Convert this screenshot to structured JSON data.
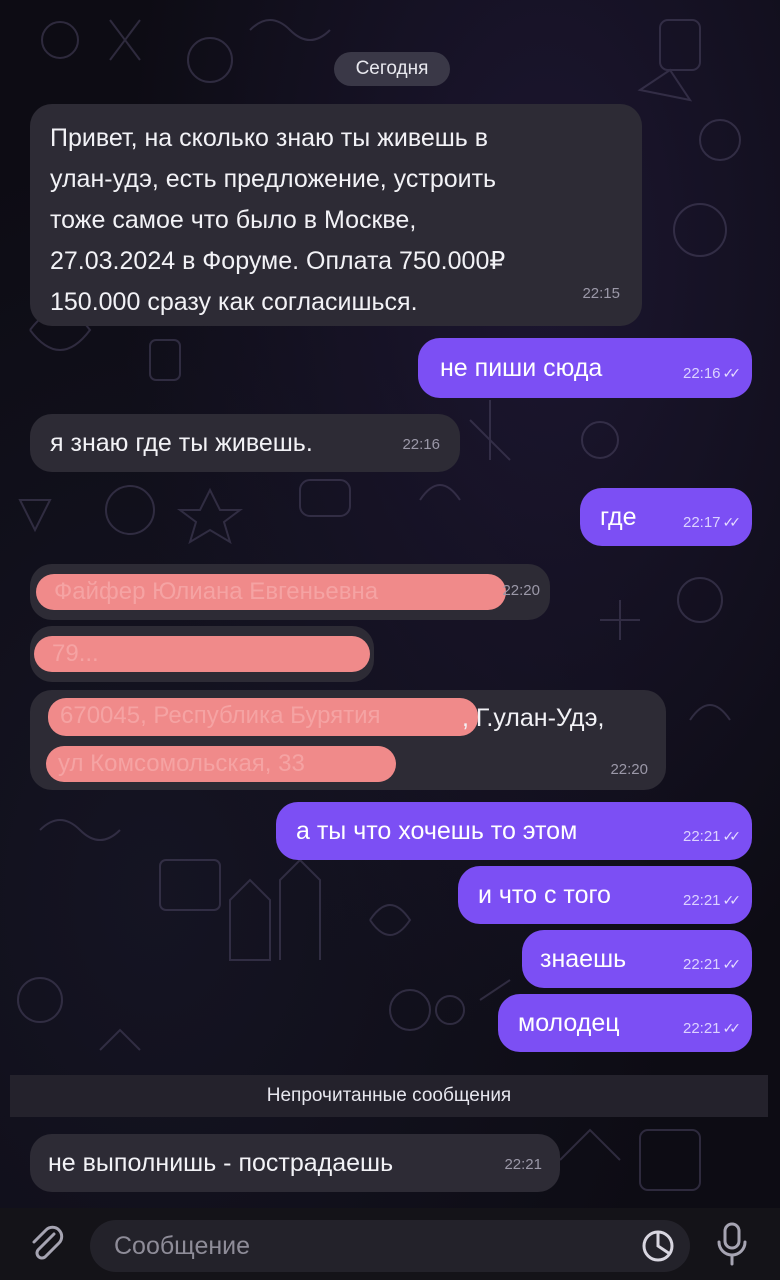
{
  "date_divider": "Сегодня",
  "messages": [
    {
      "lines": [
        "Привет, на сколько знаю ты живешь в",
        "улан-удэ, есть предложение, устроить",
        "тоже самое что было в Москве,",
        "27.03.2024 в Форуме. Оплата 750.000₽",
        "150.000 сразу как согласишься."
      ],
      "time": "22:15"
    },
    {
      "text": "не пиши сюда",
      "time": "22:16"
    },
    {
      "text": "я знаю где ты живешь.",
      "time": "22:16"
    },
    {
      "text": "где",
      "time": "22:17"
    },
    {
      "redacted_text": "Файфер Юлиана Евгеньевна",
      "time": "22:20"
    },
    {
      "redacted_text": "79..."
    },
    {
      "redacted_line1": "670045, Республика Бурятия",
      "visible_line1": ", Г.улан-Удэ,",
      "redacted_line2": "ул Комсомольская, 33",
      "time": "22:20"
    },
    {
      "text": "а ты что хочешь то этом",
      "time": "22:21"
    },
    {
      "text": "и что с того",
      "time": "22:21"
    },
    {
      "text": "знаешь",
      "time": "22:21"
    },
    {
      "text": "молодец",
      "time": "22:21"
    },
    {
      "text": "не выполнишь - пострадаешь",
      "time": "22:21"
    }
  ],
  "unread_label": "Непрочитанные сообщения",
  "composer": {
    "placeholder": "Сообщение"
  },
  "icons": {
    "attach": "paperclip-icon",
    "sticker": "sticker-icon",
    "voice": "microphone-icon"
  },
  "colors": {
    "outgoing": "#7c4ff4",
    "incoming": "#2d2b35",
    "redaction": "#f08a8a"
  }
}
